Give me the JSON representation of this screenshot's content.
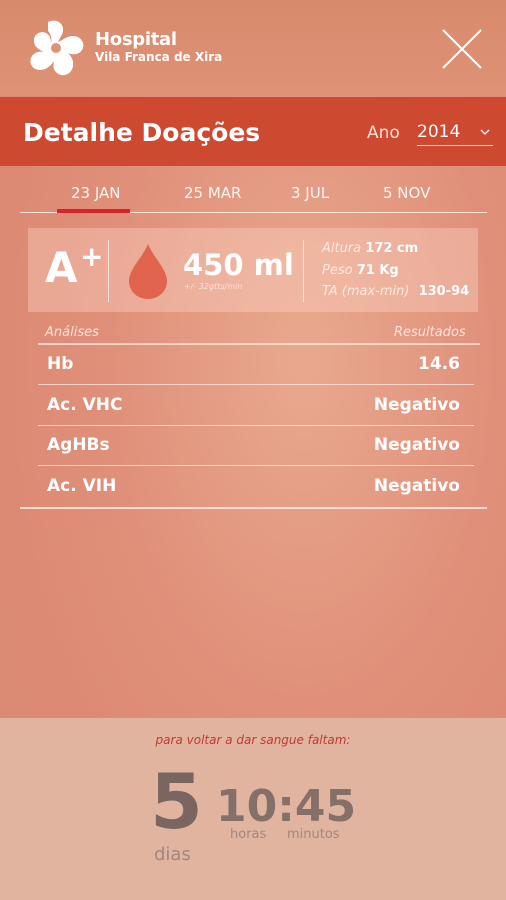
{
  "header": {
    "brand_name": "Hospital",
    "brand_sub": "Vila Franca de Xira",
    "logo_icon": "hospital-cross-logo",
    "close_icon": "close-icon"
  },
  "title": "Detalhe Doações",
  "year": {
    "label": "Ano",
    "value": "2014"
  },
  "tabs": [
    {
      "label": "23 JAN",
      "selected": true
    },
    {
      "label": "25 MAR",
      "selected": false
    },
    {
      "label": "3 JUL",
      "selected": false
    },
    {
      "label": "5 NOV",
      "selected": false
    }
  ],
  "summary": {
    "blood_type": "A",
    "blood_sign": "+",
    "volume": "450 ml",
    "rate": "+/- 32gtts/min",
    "height_label": "Altura",
    "height_value": "172 cm",
    "weight_label": "Peso",
    "weight_value": "71 Kg",
    "bp_label": "TA (max-min)",
    "bp_value": "130-94"
  },
  "analyses": {
    "col_label": "Análises",
    "col_result": "Resultados",
    "rows": [
      {
        "label": "Hb",
        "value": "14.6"
      },
      {
        "label": "Ac. VHC",
        "value": "Negativo"
      },
      {
        "label": "AgHBs",
        "value": "Negativo"
      },
      {
        "label": "Ac. VIH",
        "value": "Negativo"
      }
    ]
  },
  "countdown": {
    "caption": "para voltar a dar sangue faltam:",
    "days": "5",
    "days_label": "dias",
    "time": "10:45",
    "hours_label": "horas",
    "minutes_label": "minutos"
  },
  "colors": {
    "title_bar": "#cd4a31",
    "tab_indicator": "#d4262a",
    "drop": "#e0644e"
  }
}
